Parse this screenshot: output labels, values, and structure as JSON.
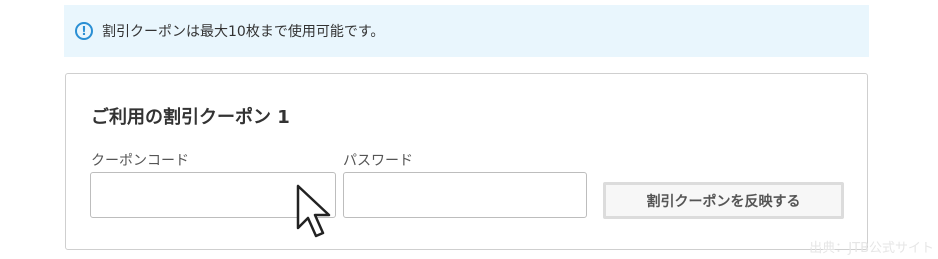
{
  "notice": {
    "icon": "info-icon",
    "text": "割引クーポンは最大10枚まで使用可能です。"
  },
  "coupon": {
    "title": "ご利用の割引クーポン 1",
    "code_label": "クーポンコード",
    "code_value": "",
    "password_label": "パスワード",
    "password_value": "",
    "apply_button": "割引クーポンを反映する"
  },
  "watermark": "出典：JTB公式サイト",
  "colors": {
    "notice_bg": "#e9f6fd",
    "info_icon": "#2a8fd4",
    "card_border": "#cfcfcf",
    "button_border": "#dcdcdc"
  }
}
